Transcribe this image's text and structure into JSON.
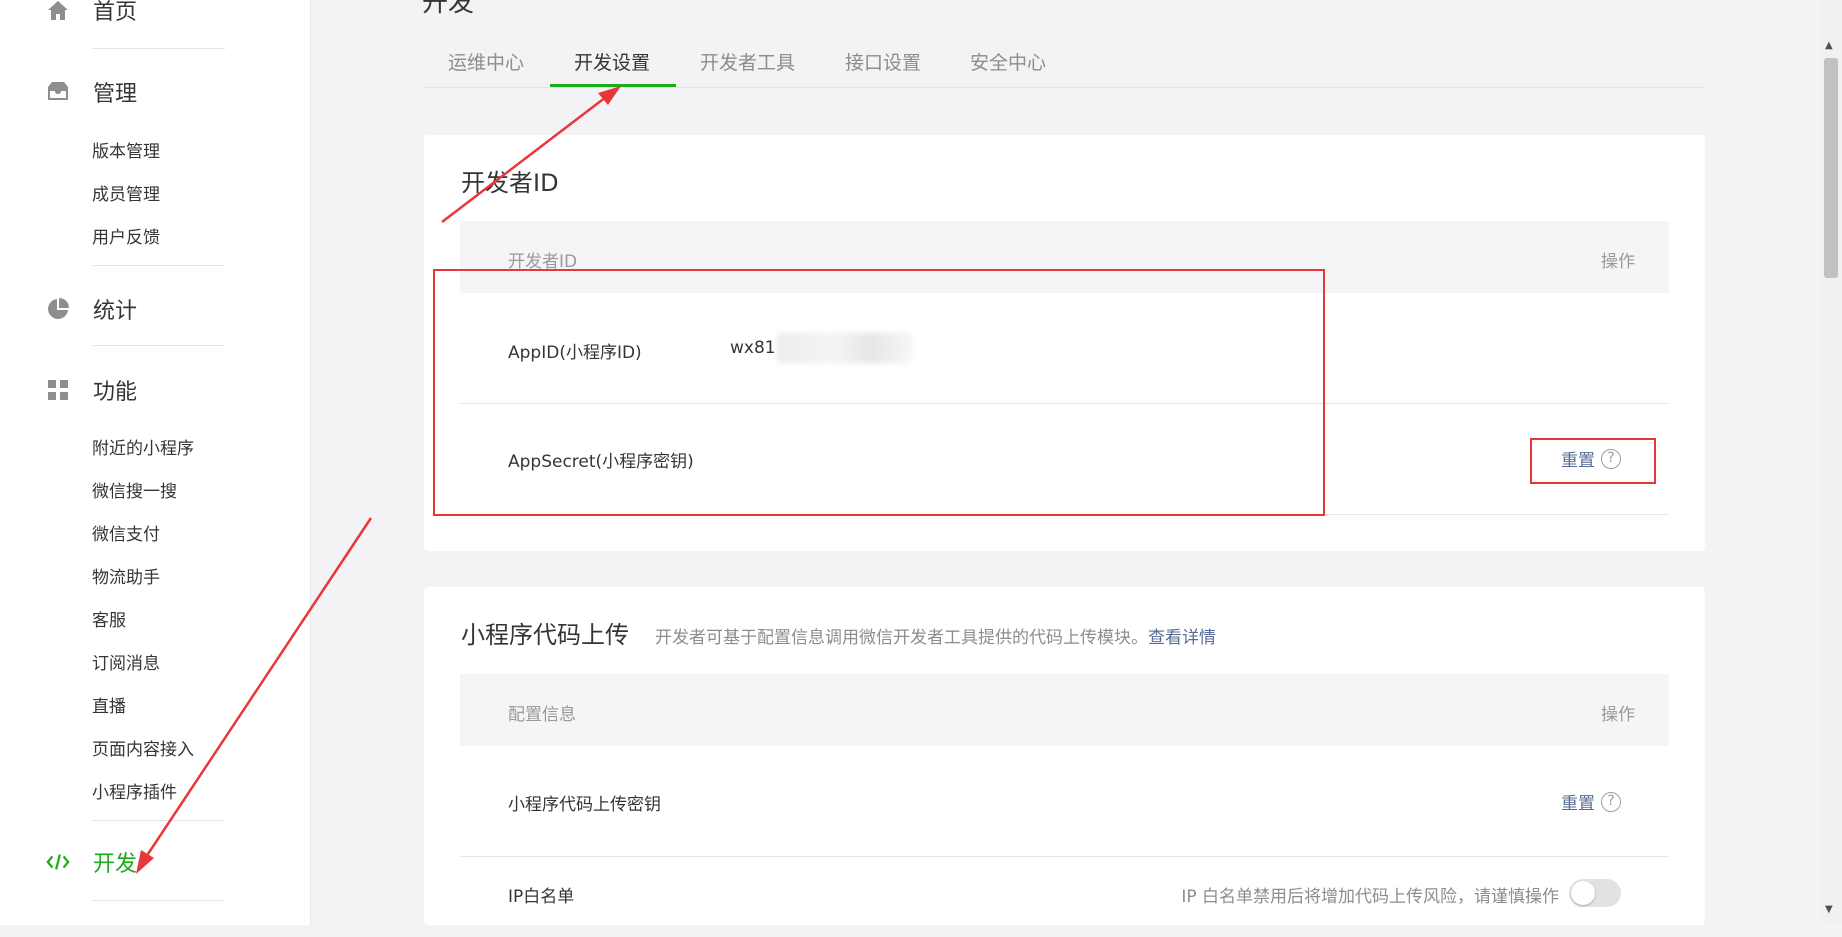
{
  "sidebar": {
    "items": [
      {
        "label": "首页",
        "icon": "home-icon"
      },
      {
        "label": "管理",
        "icon": "inbox-icon"
      },
      {
        "label": "统计",
        "icon": "pie-chart-icon"
      },
      {
        "label": "功能",
        "icon": "grid-icon"
      },
      {
        "label": "开发",
        "icon": "code-icon"
      }
    ],
    "manage_sub": [
      "版本管理",
      "成员管理",
      "用户反馈"
    ],
    "feature_sub": [
      "附近的小程序",
      "微信搜一搜",
      "微信支付",
      "物流助手",
      "客服",
      "订阅消息",
      "直播",
      "页面内容接入",
      "小程序插件"
    ],
    "active_color": "#1aad19"
  },
  "page": {
    "title": "开发"
  },
  "tabs": [
    "运维中心",
    "开发设置",
    "开发者工具",
    "接口设置",
    "安全中心"
  ],
  "active_tab": "开发设置",
  "developer_id": {
    "title": "开发者ID",
    "header_col1": "开发者ID",
    "header_col2": "操作",
    "appid_label": "AppID(小程序ID)",
    "appid_value": "wx81",
    "appsecret_label": "AppSecret(小程序密钥)",
    "reset_label": "重置",
    "help_glyph": "?"
  },
  "upload": {
    "title": "小程序代码上传",
    "desc": "开发者可基于配置信息调用微信开发者工具提供的代码上传模块。",
    "link": "查看详情",
    "header_col1": "配置信息",
    "header_col2": "操作",
    "key_label": "小程序代码上传密钥",
    "reset_label": "重置",
    "help_glyph": "?",
    "ip_label": "IP白名单",
    "ip_hint": "IP 白名单禁用后将增加代码上传风险，请谨慎操作",
    "ip_toggle_on": false
  },
  "colors": {
    "accent_green": "#1aad19",
    "link_blue": "#576b95",
    "annotation_red": "#e8373a"
  }
}
